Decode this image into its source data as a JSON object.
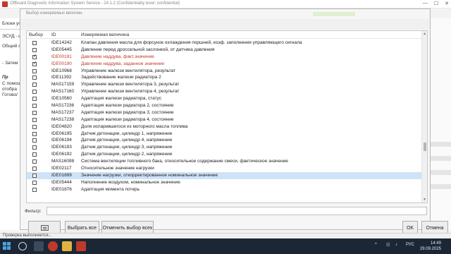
{
  "app": {
    "title": "Offboard Diagnostic Information System Service - 24.1.2 (Confidentiality level: confidential)",
    "window_controls": [
      "—",
      "☐",
      "✕"
    ]
  },
  "background": {
    "left_texts": [
      "Блоки упр",
      "ЭСУД - и",
      "Общий с",
      "- Затем",
      "Пр",
      "С помощ",
      "отобра",
      "Готово/"
    ]
  },
  "dialog": {
    "title": "Выбор измеряемых величин",
    "columns": {
      "select": "Выбор",
      "id": "ID",
      "name": "Измеряемая величина"
    },
    "rows": [
      {
        "id": "IDE14242",
        "name": "Клапан давления масла для форсунок охлаждения поршней, коэф. заполнения управляющего сигнала",
        "checked": false,
        "red": false,
        "selected": false
      },
      {
        "id": "IDE05445",
        "name": "Давление перед дроссельной заслонкой, от датчика давления",
        "checked": false,
        "red": false,
        "selected": false
      },
      {
        "id": "IDE00191",
        "name": "Давление наддува, факт.значение",
        "checked": true,
        "red": true,
        "selected": false
      },
      {
        "id": "IDE00190",
        "name": "Давление наддува, заданное значение",
        "checked": true,
        "red": true,
        "selected": false
      },
      {
        "id": "IDE10968",
        "name": "Управление жалюзи вентилятора, результат",
        "checked": false,
        "red": false,
        "selected": false
      },
      {
        "id": "IDE11392",
        "name": "Задействование жалюзи радиатора 2",
        "checked": false,
        "red": false,
        "selected": false
      },
      {
        "id": "MAS17159",
        "name": "Управление жалюзи вентилятора 3, результат",
        "checked": false,
        "red": false,
        "selected": false
      },
      {
        "id": "MAS17160",
        "name": "Управление жалюзи вентилятора 4, результат",
        "checked": false,
        "red": false,
        "selected": false
      },
      {
        "id": "IDE10560",
        "name": "Адаптация жалюзи радиатора, статус",
        "checked": false,
        "red": false,
        "selected": false
      },
      {
        "id": "MAS17236",
        "name": "Адаптация жалюзи радиатора 2, состояние",
        "checked": false,
        "red": false,
        "selected": false
      },
      {
        "id": "MAS17237",
        "name": "Адаптация жалюзи радиатора 3, состояние",
        "checked": false,
        "red": false,
        "selected": false
      },
      {
        "id": "MAS17238",
        "name": "Адаптация жалюзи радиатора 4, состояние",
        "checked": false,
        "red": false,
        "selected": false
      },
      {
        "id": "IDE04820",
        "name": "Доля испарившегося из моторного масла топлива",
        "checked": false,
        "red": false,
        "selected": false
      },
      {
        "id": "IDE06195",
        "name": "Датчик детонации, цилиндр 1, напряжение",
        "checked": false,
        "red": false,
        "selected": false
      },
      {
        "id": "IDE06194",
        "name": "Датчик детонации, цилиндр 4, напряжение",
        "checked": false,
        "red": false,
        "selected": false
      },
      {
        "id": "IDE06193",
        "name": "Датчик детонации, цилиндр 3, напряжение",
        "checked": false,
        "red": false,
        "selected": false
      },
      {
        "id": "IDE06192",
        "name": "Датчик детонации, цилиндр 2, напряжение",
        "checked": false,
        "red": false,
        "selected": false
      },
      {
        "id": "MAS16098",
        "name": "Система вентиляции топливного бака, относительное содержание смеси, фактическое значение",
        "checked": false,
        "red": false,
        "selected": false
      },
      {
        "id": "IDE02117",
        "name": "Относительное значение нагрузки",
        "checked": false,
        "red": false,
        "selected": false
      },
      {
        "id": "IDE01899",
        "name": "Значение нагрузки, откорректированное номинальное значение",
        "checked": false,
        "red": false,
        "selected": true
      },
      {
        "id": "IDE05444",
        "name": "Наполнение воздухом, номинальное значение",
        "checked": false,
        "red": false,
        "selected": false
      },
      {
        "id": "IDE01876",
        "name": "Адаптация момента потерь",
        "checked": false,
        "red": false,
        "selected": false
      }
    ],
    "filter_label": "Фильтр:",
    "filter_value": "",
    "buttons": {
      "select_all": "Выбрать все",
      "deselect_all": "Отменить выбор всех",
      "ok": "OK",
      "cancel": "Отмена"
    }
  },
  "status_bar": {
    "text": "Проверка выполняется..."
  },
  "taskbar": {
    "tray_lang": "РУС",
    "time": "14:49",
    "date": "29.09.2025"
  },
  "colors": {
    "accent_red": "#c0392b",
    "selection": "#cfe3f7",
    "taskbar": "#1b2735"
  }
}
